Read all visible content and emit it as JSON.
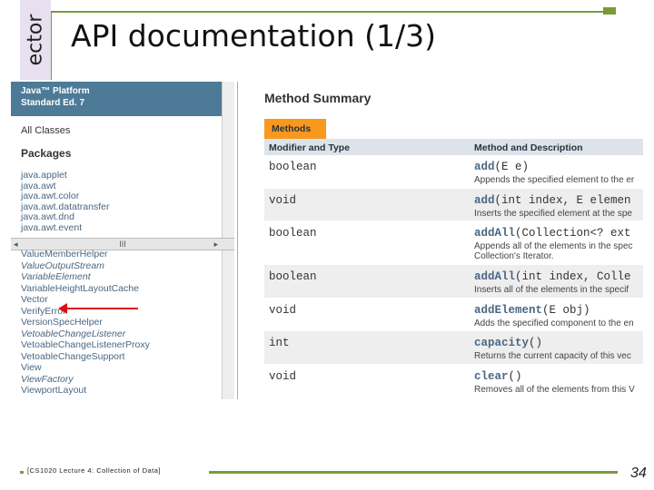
{
  "slide": {
    "side_tab": "ector",
    "title": "API documentation (1/3)",
    "footer": "[CS1020 Lecture 4: Collection of Data]",
    "page_number": "34"
  },
  "javadoc": {
    "banner_line1": "Java™ Platform",
    "banner_line2": "Standard Ed. 7",
    "all_classes": "All Classes",
    "packages_heading": "Packages",
    "packages": [
      "java.applet",
      "java.awt",
      "java.awt.color",
      "java.awt.datatransfer",
      "java.awt.dnd",
      "java.awt.event"
    ],
    "scroll_mid": "III",
    "classes": [
      {
        "name": "ValueMemberHelper",
        "italic": false
      },
      {
        "name": "ValueOutputStream",
        "italic": true
      },
      {
        "name": "VariableElement",
        "italic": true
      },
      {
        "name": "VariableHeightLayoutCache",
        "italic": false
      },
      {
        "name": "Vector",
        "italic": false
      },
      {
        "name": "VerifyError",
        "italic": false
      },
      {
        "name": "VersionSpecHelper",
        "italic": false
      },
      {
        "name": "VetoableChangeListener",
        "italic": true
      },
      {
        "name": "VetoableChangeListenerProxy",
        "italic": false
      },
      {
        "name": "VetoableChangeSupport",
        "italic": false
      },
      {
        "name": "View",
        "italic": false
      },
      {
        "name": "ViewFactory",
        "italic": true
      },
      {
        "name": "ViewportLayout",
        "italic": false
      }
    ],
    "method_summary_title": "Method Summary",
    "methods_tab": "Methods",
    "col_modifier": "Modifier and Type",
    "col_method": "Method and Description",
    "methods": [
      {
        "type": "boolean",
        "name": "add",
        "params": "(E e)",
        "desc": "Appends the specified element to the er"
      },
      {
        "type": "void",
        "name": "add",
        "params": "(int index, E elemen",
        "desc": "Inserts the specified element at the spe"
      },
      {
        "type": "boolean",
        "name": "addAll",
        "params": "(Collection<? ext",
        "desc": "Appends all of the elements in the spec",
        "desc2": "Collection's Iterator."
      },
      {
        "type": "boolean",
        "name": "addAll",
        "params": "(int index, Colle",
        "desc": "Inserts all of the elements in the specif"
      },
      {
        "type": "void",
        "name": "addElement",
        "params": "(E obj)",
        "desc": "Adds the specified component to the en"
      },
      {
        "type": "int",
        "name": "capacity",
        "params": "()",
        "desc": "Returns the current capacity of this vec"
      },
      {
        "type": "void",
        "name": "clear",
        "params": "()",
        "desc": "Removes all of the elements from this V"
      }
    ]
  },
  "colors": {
    "accent_green": "#7a9a3a",
    "banner_blue": "#4d7a97",
    "tab_orange": "#f8981d",
    "arrow_red": "#dd1111"
  }
}
